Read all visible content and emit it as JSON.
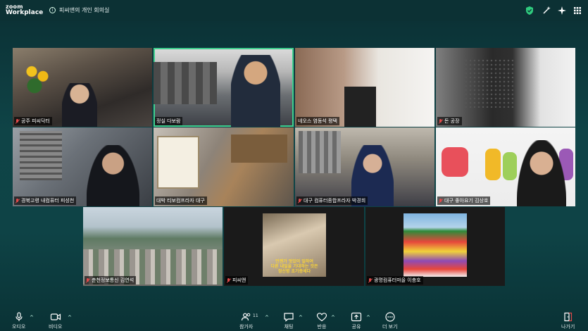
{
  "app": {
    "brand_line1": "zoom",
    "brand_line2": "Workplace",
    "meeting_title": "피씨앤의 개인 회의실",
    "info_icon": "i"
  },
  "participants": [
    {
      "name": "공주 피씨닥터",
      "muted": true
    },
    {
      "name": "정실 다보람",
      "muted": false
    },
    {
      "name": "네오스 염동석 평택",
      "muted": false
    },
    {
      "name": "돈 공장",
      "muted": true
    },
    {
      "name": "경북고령 내컴퓨터 피성천",
      "muted": true
    },
    {
      "name": "대박 티보컴프라자 대구",
      "muted": false
    },
    {
      "name": "대구 컴퓨터종합프라자 박경희",
      "muted": true
    },
    {
      "name": "대구 좋아요기 김상호",
      "muted": true
    },
    {
      "name": "춘천정보통신 김연석",
      "muted": true
    },
    {
      "name": "피씨앤",
      "muted": true
    },
    {
      "name": "광명컴퓨터마을 이충호",
      "muted": true
    }
  ],
  "slide_text": {
    "line1": "언젠가 멋있이 일하여",
    "line2": "다른 내일을 기대하는 것은",
    "line3": "정신병 초기증세다"
  },
  "toolbar": {
    "audio": "오디오",
    "video": "비디오",
    "participants": "참가자",
    "participants_count": "11",
    "chat": "채팅",
    "reactions": "반응",
    "share": "공유",
    "more": "더 보기",
    "leave": "나가기"
  },
  "colors": {
    "active_border": "#3fcf8e",
    "bg": "#0e3b3e",
    "muted_red": "#e04a4a"
  }
}
